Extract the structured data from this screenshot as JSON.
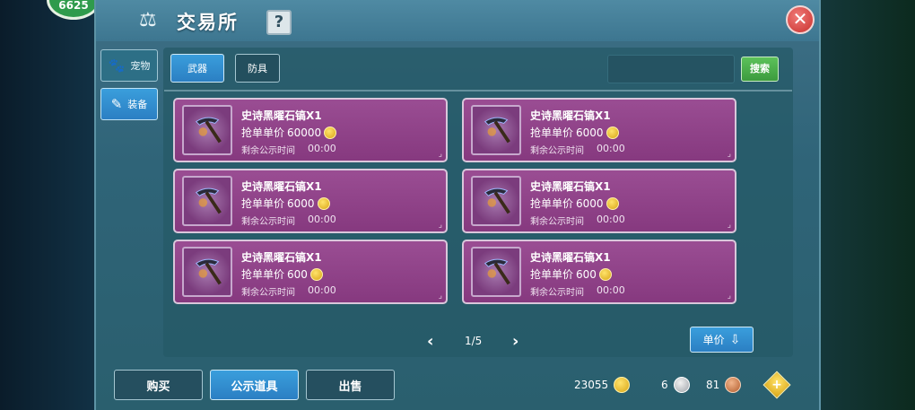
{
  "level_badge": "6625",
  "title": "交易所",
  "help_label": "?",
  "side_tabs": [
    {
      "label": "宠物",
      "icon": "paw-icon"
    },
    {
      "label": "装备",
      "icon": "equipment-icon"
    }
  ],
  "category_tabs": [
    {
      "label": "武器",
      "active": true
    },
    {
      "label": "防具",
      "active": false
    }
  ],
  "search": {
    "placeholder": "",
    "button_label": "搜索"
  },
  "listings": [
    {
      "name": "史诗黑曜石镐X1",
      "price_label": "抢单单价",
      "price": "60000",
      "time_label": "剩余公示时间",
      "time": "00:00"
    },
    {
      "name": "史诗黑曜石镐X1",
      "price_label": "抢单单价",
      "price": "6000",
      "time_label": "剩余公示时间",
      "time": "00:00"
    },
    {
      "name": "史诗黑曜石镐X1",
      "price_label": "抢单单价",
      "price": "6000",
      "time_label": "剩余公示时间",
      "time": "00:00"
    },
    {
      "name": "史诗黑曜石镐X1",
      "price_label": "抢单单价",
      "price": "6000",
      "time_label": "剩余公示时间",
      "time": "00:00"
    },
    {
      "name": "史诗黑曜石镐X1",
      "price_label": "抢单单价",
      "price": "600",
      "time_label": "剩余公示时间",
      "time": "00:00"
    },
    {
      "name": "史诗黑曜石镐X1",
      "price_label": "抢单单价",
      "price": "600",
      "time_label": "剩余公示时间",
      "time": "00:00"
    }
  ],
  "pager": {
    "indicator": "1/5",
    "prev": "‹",
    "next": "›"
  },
  "sort_button": "单价",
  "bottom_tabs": [
    {
      "label": "购买"
    },
    {
      "label": "公示道具",
      "active": true
    },
    {
      "label": "出售"
    }
  ],
  "currencies": {
    "gold": "23055",
    "silver": "6",
    "copper": "81"
  },
  "colors": {
    "card_purple": "#8f4289",
    "active_blue": "#2b7fc3",
    "search_green": "#4caf50",
    "close_red": "#d9423d"
  }
}
